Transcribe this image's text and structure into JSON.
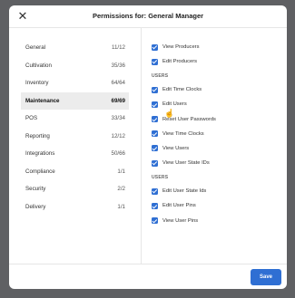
{
  "modal": {
    "title": "Permissions for: General Manager",
    "close_icon": "close-icon",
    "save_label": "Save"
  },
  "sidebar": {
    "items": [
      {
        "label": "General",
        "count": "11/12"
      },
      {
        "label": "Cultivation",
        "count": "35/36"
      },
      {
        "label": "Inventory",
        "count": "64/64"
      },
      {
        "label": "Maintenance",
        "count": "69/69",
        "active": true
      },
      {
        "label": "POS",
        "count": "33/34"
      },
      {
        "label": "Reporting",
        "count": "12/12"
      },
      {
        "label": "Integrations",
        "count": "50/66"
      },
      {
        "label": "Compliance",
        "count": "1/1"
      },
      {
        "label": "Security",
        "count": "2/2"
      },
      {
        "label": "Delivery",
        "count": "1/1"
      }
    ]
  },
  "permissions": {
    "top": [
      "View Producers",
      "Edit Producers"
    ],
    "section1": {
      "heading": "USERS",
      "items": [
        "Edit Time Clocks",
        "Edit Users",
        "Reset User Passwords",
        "View Time Clocks",
        "View Users",
        "View User State IDs"
      ]
    },
    "section2": {
      "heading": "USERS",
      "items": [
        "Edit User State Ids",
        "Edit User Pins",
        "View User Pins"
      ]
    }
  },
  "colors": {
    "accent": "#2f6fd3",
    "backdrop": "#5f6063"
  }
}
